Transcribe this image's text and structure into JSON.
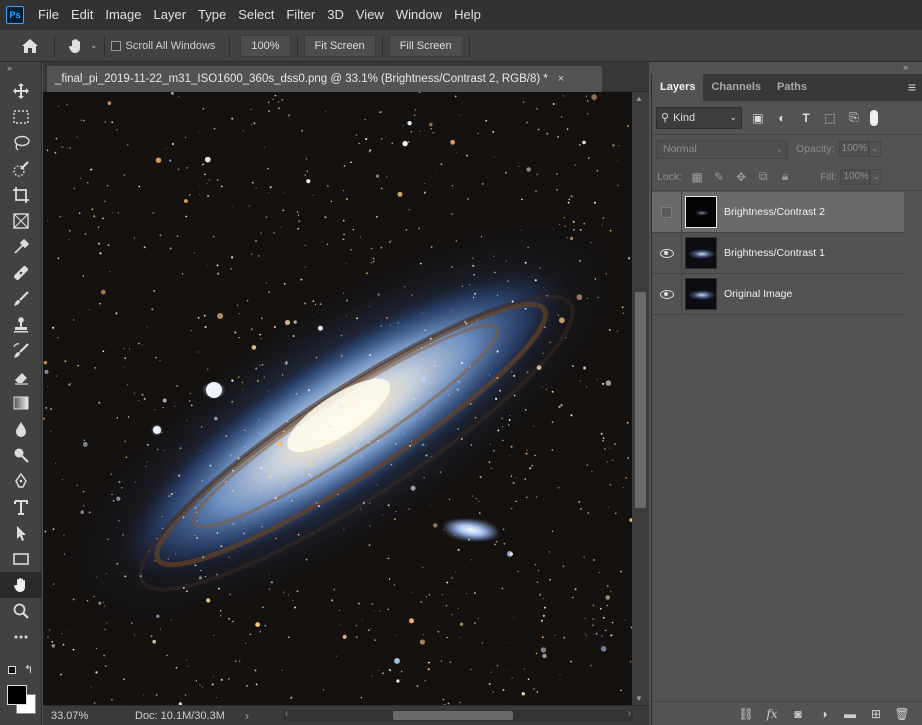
{
  "app": {
    "logo": "Ps",
    "menu": [
      "File",
      "Edit",
      "Image",
      "Layer",
      "Type",
      "Select",
      "Filter",
      "3D",
      "View",
      "Window",
      "Help"
    ]
  },
  "options": {
    "scroll_all_label": "Scroll All Windows",
    "scroll_all_checked": false,
    "zoom_btn": "100%",
    "fit_screen": "Fit Screen",
    "fill_screen": "Fill Screen"
  },
  "toolbar": {
    "collapse": "»",
    "tools": [
      "move-tool",
      "rectangular-marquee-tool",
      "lasso-tool",
      "quick-selection-tool",
      "crop-tool",
      "frame-tool",
      "eyedropper-tool",
      "healing-brush-tool",
      "brush-tool",
      "clone-stamp-tool",
      "history-brush-tool",
      "eraser-tool",
      "gradient-tool",
      "blur-tool",
      "dodge-tool",
      "pen-tool",
      "type-tool",
      "path-selection-tool",
      "rectangle-tool",
      "hand-tool",
      "zoom-tool",
      "more-tools"
    ],
    "active_tool": "hand-tool",
    "foreground_color": "#000000",
    "background_color": "#ffffff"
  },
  "document": {
    "collapse": "»",
    "tab_title": "_final_pi_2019-11-22_m31_ISO1600_360s_dss0.png @ 33.1% (Brightness/Contrast 2, RGB/8) *",
    "close": "×",
    "zoom": "33.07%",
    "doc_size": "Doc: 10.1M/30.3M",
    "status_arrow": "›"
  },
  "layers_panel": {
    "collapse": "»",
    "tabs": [
      "Layers",
      "Channels",
      "Paths"
    ],
    "active_tab": "Layers",
    "menu_icon": "≡",
    "filter_kind": "Kind",
    "blend_mode": "Normal",
    "opacity_label": "Opacity:",
    "opacity": "100%",
    "lock_label": "Lock:",
    "fill_label": "Fill:",
    "fill": "100%",
    "layers": [
      {
        "name": "Brightness/Contrast 2",
        "visible": false,
        "selected": true,
        "type": "adjustment"
      },
      {
        "name": "Brightness/Contrast 1",
        "visible": true,
        "selected": false,
        "type": "image"
      },
      {
        "name": "Original Image",
        "visible": true,
        "selected": false,
        "type": "image"
      }
    ]
  }
}
